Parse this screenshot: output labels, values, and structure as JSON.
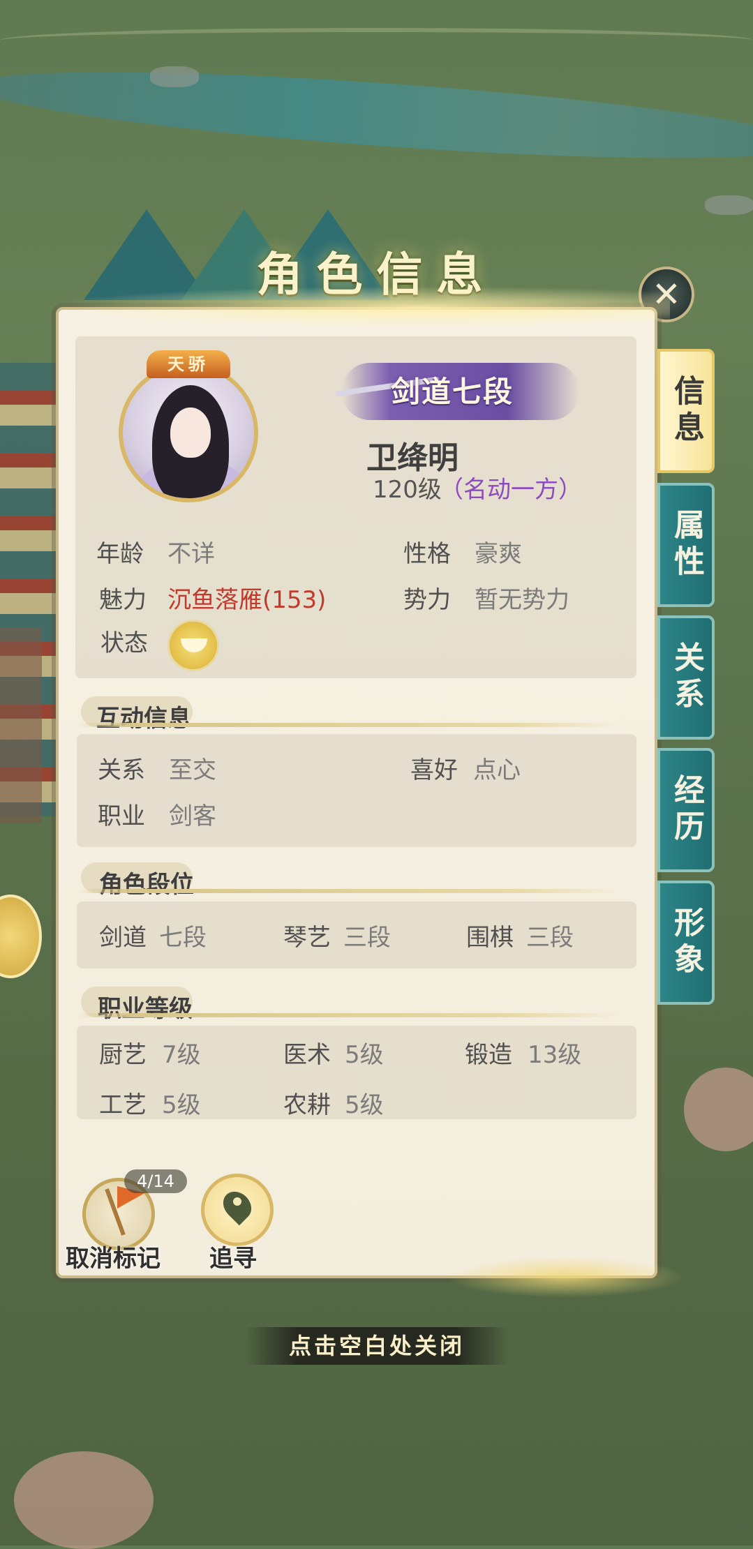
{
  "window": {
    "title": "角色信息",
    "close_icon": "close-icon"
  },
  "profile": {
    "crown_label": "天骄",
    "rank_badge": "剑道七段",
    "name": "卫绛明",
    "level": "120级",
    "level_title": "（名动一方）"
  },
  "basic_info": {
    "age_label": "年龄",
    "age_value": "不详",
    "personality_label": "性格",
    "personality_value": "豪爽",
    "charm_label": "魅力",
    "charm_value": "沉鱼落雁(153)",
    "faction_label": "势力",
    "faction_value": "暂无势力",
    "status_label": "状态",
    "status_icon": "bowl-icon"
  },
  "interaction": {
    "title": "互动信息",
    "relation_label": "关系",
    "relation_value": "至交",
    "hobby_label": "喜好",
    "hobby_value": "点心",
    "job_label": "职业",
    "job_value": "剑客"
  },
  "ranks": {
    "title": "角色段位",
    "items": [
      {
        "label": "剑道",
        "value": "七段"
      },
      {
        "label": "琴艺",
        "value": "三段"
      },
      {
        "label": "围棋",
        "value": "三段"
      }
    ]
  },
  "job_levels": {
    "title": "职业等级",
    "items": [
      {
        "label": "厨艺",
        "value": "7级"
      },
      {
        "label": "医术",
        "value": "5级"
      },
      {
        "label": "锻造",
        "value": "13级"
      },
      {
        "label": "工艺",
        "value": "5级"
      },
      {
        "label": "农耕",
        "value": "5级"
      }
    ]
  },
  "tabs": [
    {
      "label": "信息",
      "active": true
    },
    {
      "label": "属性",
      "active": false
    },
    {
      "label": "关系",
      "active": false
    },
    {
      "label": "经历",
      "active": false
    },
    {
      "label": "形象",
      "active": false
    }
  ],
  "actions": {
    "cancel_mark_label": "取消标记",
    "cancel_mark_counter": "4/14",
    "track_label": "追寻"
  },
  "hint": "点击空白处关闭",
  "colors": {
    "accent_gold": "#d8b866",
    "tab_teal": "#1f6e72",
    "charm_red": "#c13a2e",
    "title_purple": "#8d4bc0"
  }
}
